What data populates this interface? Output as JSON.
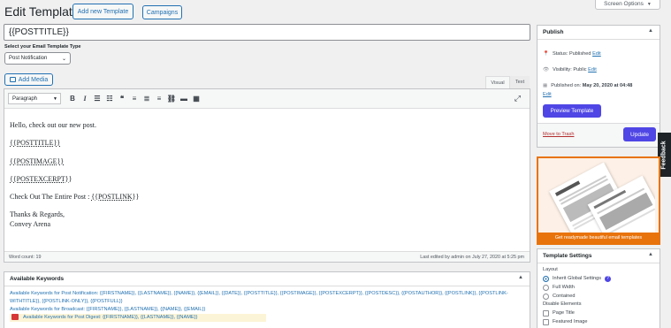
{
  "header": {
    "title": "Edit Templates",
    "add_new": "Add new Template",
    "campaigns": "Campaigns",
    "screen_options": "Screen Options"
  },
  "editor": {
    "post_title": "{{POSTTITLE}}",
    "template_type_label": "Select your Email Template Type",
    "template_type_value": "Post Notification",
    "add_media": "Add Media",
    "tab_visual": "Visual",
    "tab_text": "Text",
    "format_select": "Paragraph",
    "content": {
      "line1": "Hello, check out our new post.",
      "line2": "{{POSTTITLE}}",
      "line3": "{{POSTIMAGE}}",
      "line4": "{{POSTEXCERPT}}",
      "line5_prefix": "Check Out The Entire Post : ",
      "line5_link": "{{POSTLINK}}",
      "line6": "Thanks & Regards,",
      "line7": "Convey Arena"
    },
    "word_count": "Word count: 19",
    "last_edited": "Last edited by admin on July 27, 2020 at 5:25 pm"
  },
  "keywords": {
    "title": "Available Keywords",
    "line1_label": "Available Keywords",
    "line1_rest": " for Post Notification: {{FIRSTNAME}}, {{LASTNAME}}, {{NAME}}, {{EMAIL}}, {{DATE}}, {{POSTTITLE}}, {{POSTIMAGE}}, {{POSTEXCERPT}}, {{POSTDESC}}, {{POSTAUTHOR}}, {{POSTLINK}}, {{POSTLINK-",
    "line2": "WITHTITLE}}, {{POSTLINK-ONLY}}, {{POSTFULL}}",
    "line3_label": "Available Keywords",
    "line3_rest": " for Broadcast: {{FIRSTNAME}}, {{LASTNAME}}, {{NAME}}, {{EMAIL}}",
    "line4_label": "Available Keywords",
    "line4_rest": " for Post Digest: {{FIRSTNAME}}, {{LASTNAME}}, {{NAME}}"
  },
  "publish": {
    "title": "Publish",
    "status_label": "Status: ",
    "status_value": "Published",
    "visibility_label": "Visibility: ",
    "visibility_value": "Public",
    "published_label": "Published on: ",
    "published_value": "May 20, 2020 at 04:48",
    "edit": "Edit",
    "preview": "Preview Template",
    "trash": "Move to Trash",
    "update": "Update"
  },
  "promo": {
    "caption": "Get readymade beautiful email templates"
  },
  "feedback": "Feedback",
  "settings": {
    "title": "Template Settings",
    "layout_label": "Layout",
    "inherit": "Inherit Global Settings",
    "full_width": "Full Width",
    "contained": "Contained",
    "disable_label": "Disable Elements",
    "page_title": "Page Title",
    "featured_image": "Featured Image"
  },
  "colors": {
    "accent": "#2271b1",
    "primary_button": "#4f46e5",
    "promo_orange": "#e8730c",
    "trash_red": "#b32d2e"
  }
}
